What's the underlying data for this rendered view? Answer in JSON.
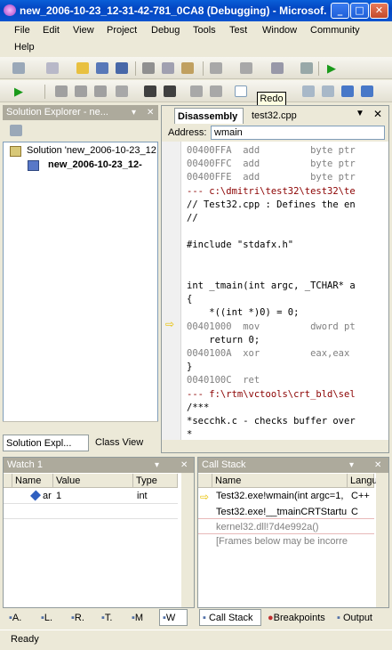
{
  "window": {
    "title": "new_2006-10-23_12-31-42-781_0CA8 (Debugging) - Microsof...",
    "min": "_",
    "max": "□",
    "close": "✕"
  },
  "menu": {
    "items": [
      "File",
      "Edit",
      "View",
      "Project",
      "Debug",
      "Tools",
      "Test",
      "Window",
      "Community",
      "Help"
    ]
  },
  "tooltip": "Redo",
  "solution_explorer": {
    "title": "Solution Explorer - ne...",
    "pin": "▾",
    "close": "✕",
    "tree": [
      "Solution 'new_2006-10-23_12",
      "new_2006-10-23_12-"
    ],
    "tabs": [
      "Solution Expl...",
      "Class View"
    ]
  },
  "disassembly": {
    "tabs": [
      "Disassembly",
      "test32.cpp"
    ],
    "address_label": "Address:",
    "address_value": "wmain",
    "lines": [
      {
        "t": "00400FFA  add         byte ptr",
        "c": "addr"
      },
      {
        "t": "00400FFC  add         byte ptr",
        "c": "addr"
      },
      {
        "t": "00400FFE  add         byte ptr",
        "c": "addr"
      },
      {
        "t": "--- c:\\dmitri\\test32\\test32\\te",
        "c": "red"
      },
      {
        "t": "// Test32.cpp : Defines the en",
        "c": ""
      },
      {
        "t": "//",
        "c": ""
      },
      {
        "t": "",
        "c": ""
      },
      {
        "t": "#include \"stdafx.h\"",
        "c": ""
      },
      {
        "t": "",
        "c": ""
      },
      {
        "t": "",
        "c": ""
      },
      {
        "t": "int _tmain(int argc, _TCHAR* a",
        "c": ""
      },
      {
        "t": "{",
        "c": ""
      },
      {
        "t": "    *((int *)0) = 0;",
        "c": ""
      },
      {
        "t": "00401000  mov         dword pt",
        "c": "addr"
      },
      {
        "t": "    return 0;",
        "c": ""
      },
      {
        "t": "0040100A  xor         eax,eax",
        "c": "addr"
      },
      {
        "t": "}",
        "c": ""
      },
      {
        "t": "0040100C  ret",
        "c": "addr"
      },
      {
        "t": "--- f:\\rtm\\vctools\\crt_bld\\sel",
        "c": "red"
      },
      {
        "t": "/***",
        "c": ""
      },
      {
        "t": "*secchk.c - checks buffer over",
        "c": ""
      },
      {
        "t": "*",
        "c": ""
      }
    ]
  },
  "watch": {
    "title": "Watch 1",
    "headers": [
      "Name",
      "Value",
      "Type"
    ],
    "rows": [
      [
        "ar",
        "1",
        "int"
      ]
    ]
  },
  "callstack": {
    "title": "Call Stack",
    "headers": [
      "Name",
      "Langu"
    ],
    "rows": [
      [
        "Test32.exe!wmain(int argc=1,",
        "C++"
      ],
      [
        "Test32.exe!__tmainCRTStartu",
        "C"
      ],
      [
        "kernel32.dll!7d4e992a()",
        ""
      ],
      [
        "[Frames below may be incorrec",
        ""
      ]
    ]
  },
  "bottom_tabs_left": [
    "A.",
    "L.",
    "R.",
    "T.",
    "M",
    "W"
  ],
  "bottom_tabs_right": [
    "Call Stack",
    "Breakpoints",
    "Output"
  ],
  "status": "Ready"
}
